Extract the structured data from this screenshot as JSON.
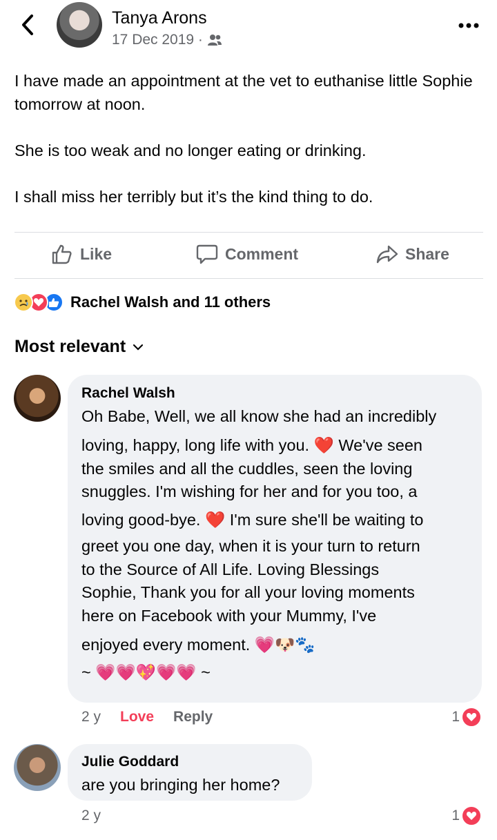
{
  "post": {
    "author": "Tanya Arons",
    "date": "17 Dec 2019 ·",
    "paragraphs": [
      "I have made an appointment at the vet to euthanise little Sophie tomorrow at noon.",
      "She is too weak and no longer eating or drinking.",
      "I shall miss her terribly but it’s the kind thing to do."
    ]
  },
  "actions": {
    "like": "Like",
    "comment": "Comment",
    "share": "Share"
  },
  "reactions": {
    "summary": "Rachel Walsh and 11 others"
  },
  "sort": {
    "label": "Most relevant"
  },
  "comments": [
    {
      "author": "Rachel Walsh",
      "lines": [
        "Oh Babe, Well, we all know she had an incredibly",
        "loving, happy, long life with you. ❤️ We've seen",
        "the smiles and all the cuddles, seen the loving",
        "snuggles. I'm wishing for her and for you too, a",
        "loving good-bye. ❤️ I'm sure she'll be waiting to",
        "greet you one day, when it is your turn to return",
        "to the Source of All Life. Loving Blessings",
        "Sophie, Thank you for all your loving moments",
        "here on Facebook with your Mummy, I've",
        "enjoyed every moment. 💗🐶🐾",
        "~ 💗💗💖💗💗 ~"
      ],
      "time": "2 y",
      "reaction": "Love",
      "reply": "Reply",
      "count": "1"
    },
    {
      "author": "Julie Goddard",
      "lines": [
        "are you bringing her home?"
      ],
      "time": "2 y",
      "count": "1"
    }
  ],
  "colors": {
    "secondary_text": "#65676b",
    "love": "#f33e58",
    "like_blue": "#1877f2",
    "bubble": "#f0f2f5"
  }
}
